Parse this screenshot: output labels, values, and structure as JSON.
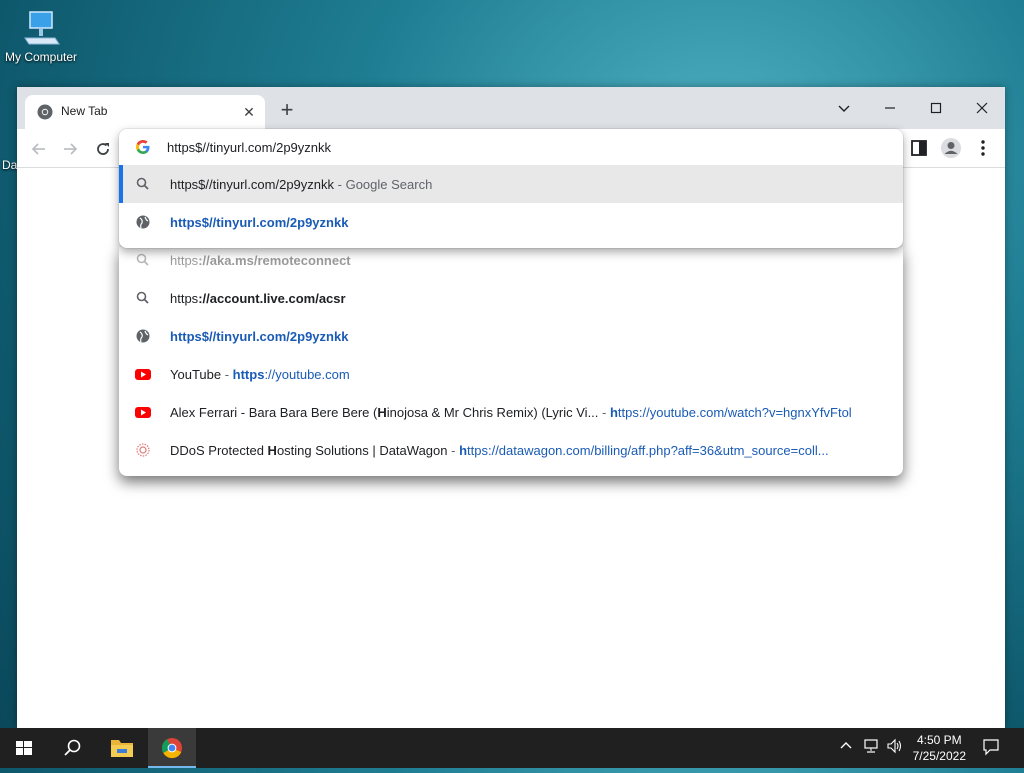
{
  "desktop": {
    "icon_label": "My Computer",
    "side_label": "Da"
  },
  "browser": {
    "tab_title": "New Tab",
    "tab_close": "✕",
    "new_tab": "+",
    "omnibox_value": "https$//tinyurl.com/2p9yznkk",
    "dropdown": {
      "selected": {
        "text": "https$//tinyurl.com/2p9yznkk",
        "suffix": " - Google Search"
      },
      "url_item": {
        "text": "https$//tinyurl.com/2p9yznkk"
      }
    },
    "history_dropdown": [
      {
        "icon": "search-icon",
        "prefix": "https",
        "bold": "://aka.ms/remoteconnect"
      },
      {
        "icon": "search-icon",
        "prefix": "https",
        "bold": "://account.live.com/acsr"
      },
      {
        "icon": "globe-icon",
        "text": "https$//tinyurl.com/2p9yznkk"
      },
      {
        "icon": "youtube-icon",
        "title": "YouTube",
        "sep": " - ",
        "url_bold": "https",
        "url": "://youtube.com"
      },
      {
        "icon": "youtube-icon",
        "title_a": "Alex Ferrari - Bara Bara Bere Bere (",
        "title_b": "H",
        "title_c": "inojosa & Mr Chris Remix) (Lyric Vi...",
        "sep": "  - ",
        "url_bold": "h",
        "url": "ttps://youtube.com/watch?v=hgnxYfvFtol"
      },
      {
        "icon": "datawagon-icon",
        "title_a": "DDoS Protected ",
        "title_b": "H",
        "title_c": "osting Solutions | DataWagon",
        "sep": " - ",
        "url_bold": "h",
        "url": "ttps://datawagon.com/billing/aff.php?aff=36&utm_source=coll..."
      }
    ]
  },
  "taskbar": {
    "time": "4:50 PM",
    "date": "7/25/2022"
  },
  "colors": {
    "accent": "#1a73e8",
    "link": "#1a5bb5",
    "taskbar": "#202020"
  }
}
